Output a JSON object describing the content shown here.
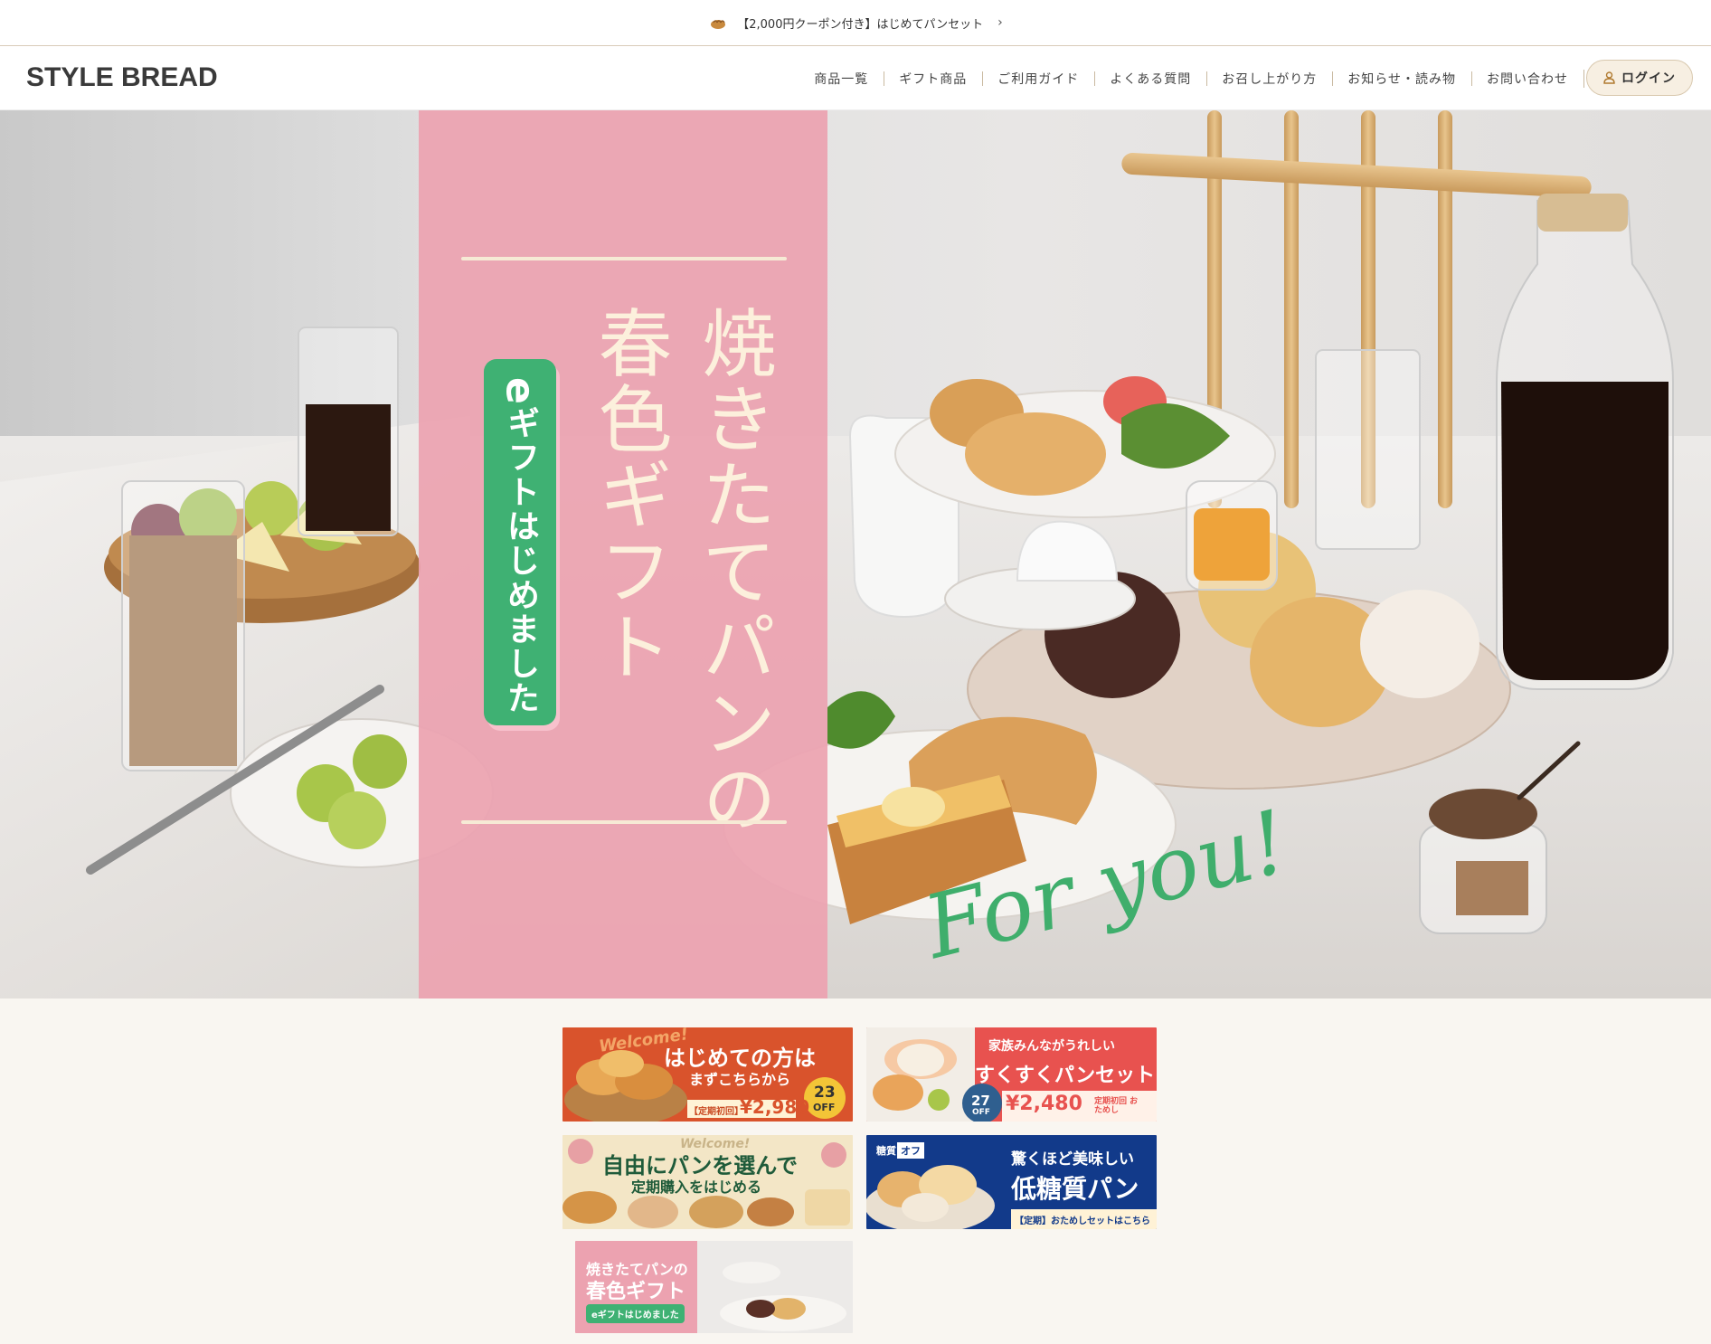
{
  "announcement": {
    "text": "【2,000円クーポン付き】はじめてパンセット",
    "chevron": "›"
  },
  "header": {
    "logo": "STYLE BREAD",
    "nav": [
      "商品一覧",
      "ギフト商品",
      "ご利用ガイド",
      "よくある質問",
      "お召し上がり方",
      "お知らせ・読み物",
      "お問い合わせ"
    ],
    "login": "ログイン"
  },
  "hero": {
    "title_col1": "焼きたてパンの",
    "title_col2": "春色ギフト",
    "badge": "ギフトはじめました",
    "badge_e": "e",
    "script": "For you!",
    "colors": {
      "pink": "#eca2b0",
      "green": "#3fb173",
      "cream": "#fcf0dc"
    }
  },
  "banners": {
    "b1": {
      "script": "Welcome!",
      "title": "はじめての方は",
      "sub": "まずこちらから",
      "plan": "【定期初回】",
      "price": "¥2,980",
      "off_pct": "23",
      "off_label": "OFF"
    },
    "b2": {
      "top": "家族みんながうれしい",
      "title": "すくすくパンセット",
      "off_pct": "27",
      "off_label": "OFF",
      "price": "¥2,480",
      "plan": "定期初回 おためし"
    },
    "b3": {
      "script": "Welcome!",
      "title": "自由にパンを選んで",
      "sub": "定期購入をはじめる"
    },
    "b4": {
      "tag1": "糖質",
      "tag2": "オフ",
      "top": "驚くほど美味しい",
      "title": "低糖質パン",
      "sub": "【定期】おためしセットはこちら"
    },
    "b5": {
      "line1": "焼きたてパンの",
      "line2": "春色ギフト",
      "badge": "eギフトはじめました"
    }
  }
}
